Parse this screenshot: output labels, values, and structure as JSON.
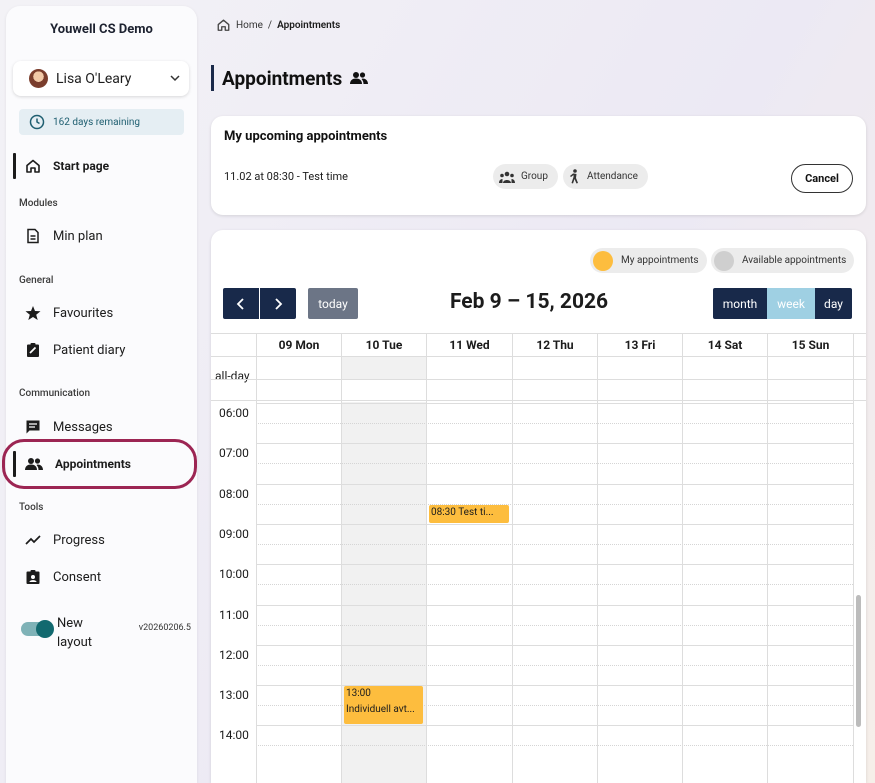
{
  "sidebar": {
    "app_title": "Youwell CS Demo",
    "user_name": "Lisa O'Leary",
    "days_remaining": "162 days remaining",
    "start_page": "Start page",
    "sections": {
      "modules": "Modules",
      "general": "General",
      "communication": "Communication",
      "tools": "Tools"
    },
    "items": {
      "min_plan": "Min plan",
      "favourites": "Favourites",
      "patient_diary": "Patient diary",
      "messages": "Messages",
      "appointments": "Appointments",
      "progress": "Progress",
      "consent": "Consent"
    },
    "toggle_label": "New layout",
    "version": "v20260206.5"
  },
  "breadcrumb": {
    "home": "Home",
    "separator": "/",
    "current": "Appointments"
  },
  "page_title": "Appointments",
  "upcoming": {
    "title": "My upcoming appointments",
    "appointment_date": "11.02 at 08:30",
    "appointment_name": " - Test time",
    "chip_group": "Group",
    "chip_attendance": "Attendance",
    "cancel_label": "Cancel"
  },
  "calendar": {
    "legend_mine": "My appointments",
    "legend_available": "Available appointments",
    "legend_mine_color": "#fdbd3e",
    "legend_available_color": "#cfcfcf",
    "today_label": "today",
    "range_title": "Feb 9 – 15, 2026",
    "views": {
      "month": "month",
      "week": "week",
      "day": "day"
    },
    "active_view": "week",
    "allday_label": "all-day",
    "days": [
      "09 Mon",
      "10 Tue",
      "11 Wed",
      "12 Thu",
      "13 Fri",
      "14 Sat",
      "15 Sun"
    ],
    "today_index": 1,
    "times": [
      "06:00",
      "07:00",
      "08:00",
      "09:00",
      "10:00",
      "11:00",
      "12:00",
      "13:00",
      "14:00"
    ],
    "events": [
      {
        "label": "08:30 Test ti...",
        "day": "11 Wed",
        "start": "08:30"
      },
      {
        "time": "13:00",
        "label": "Individuell avt...",
        "day": "10 Tue",
        "start": "13:00"
      }
    ]
  }
}
